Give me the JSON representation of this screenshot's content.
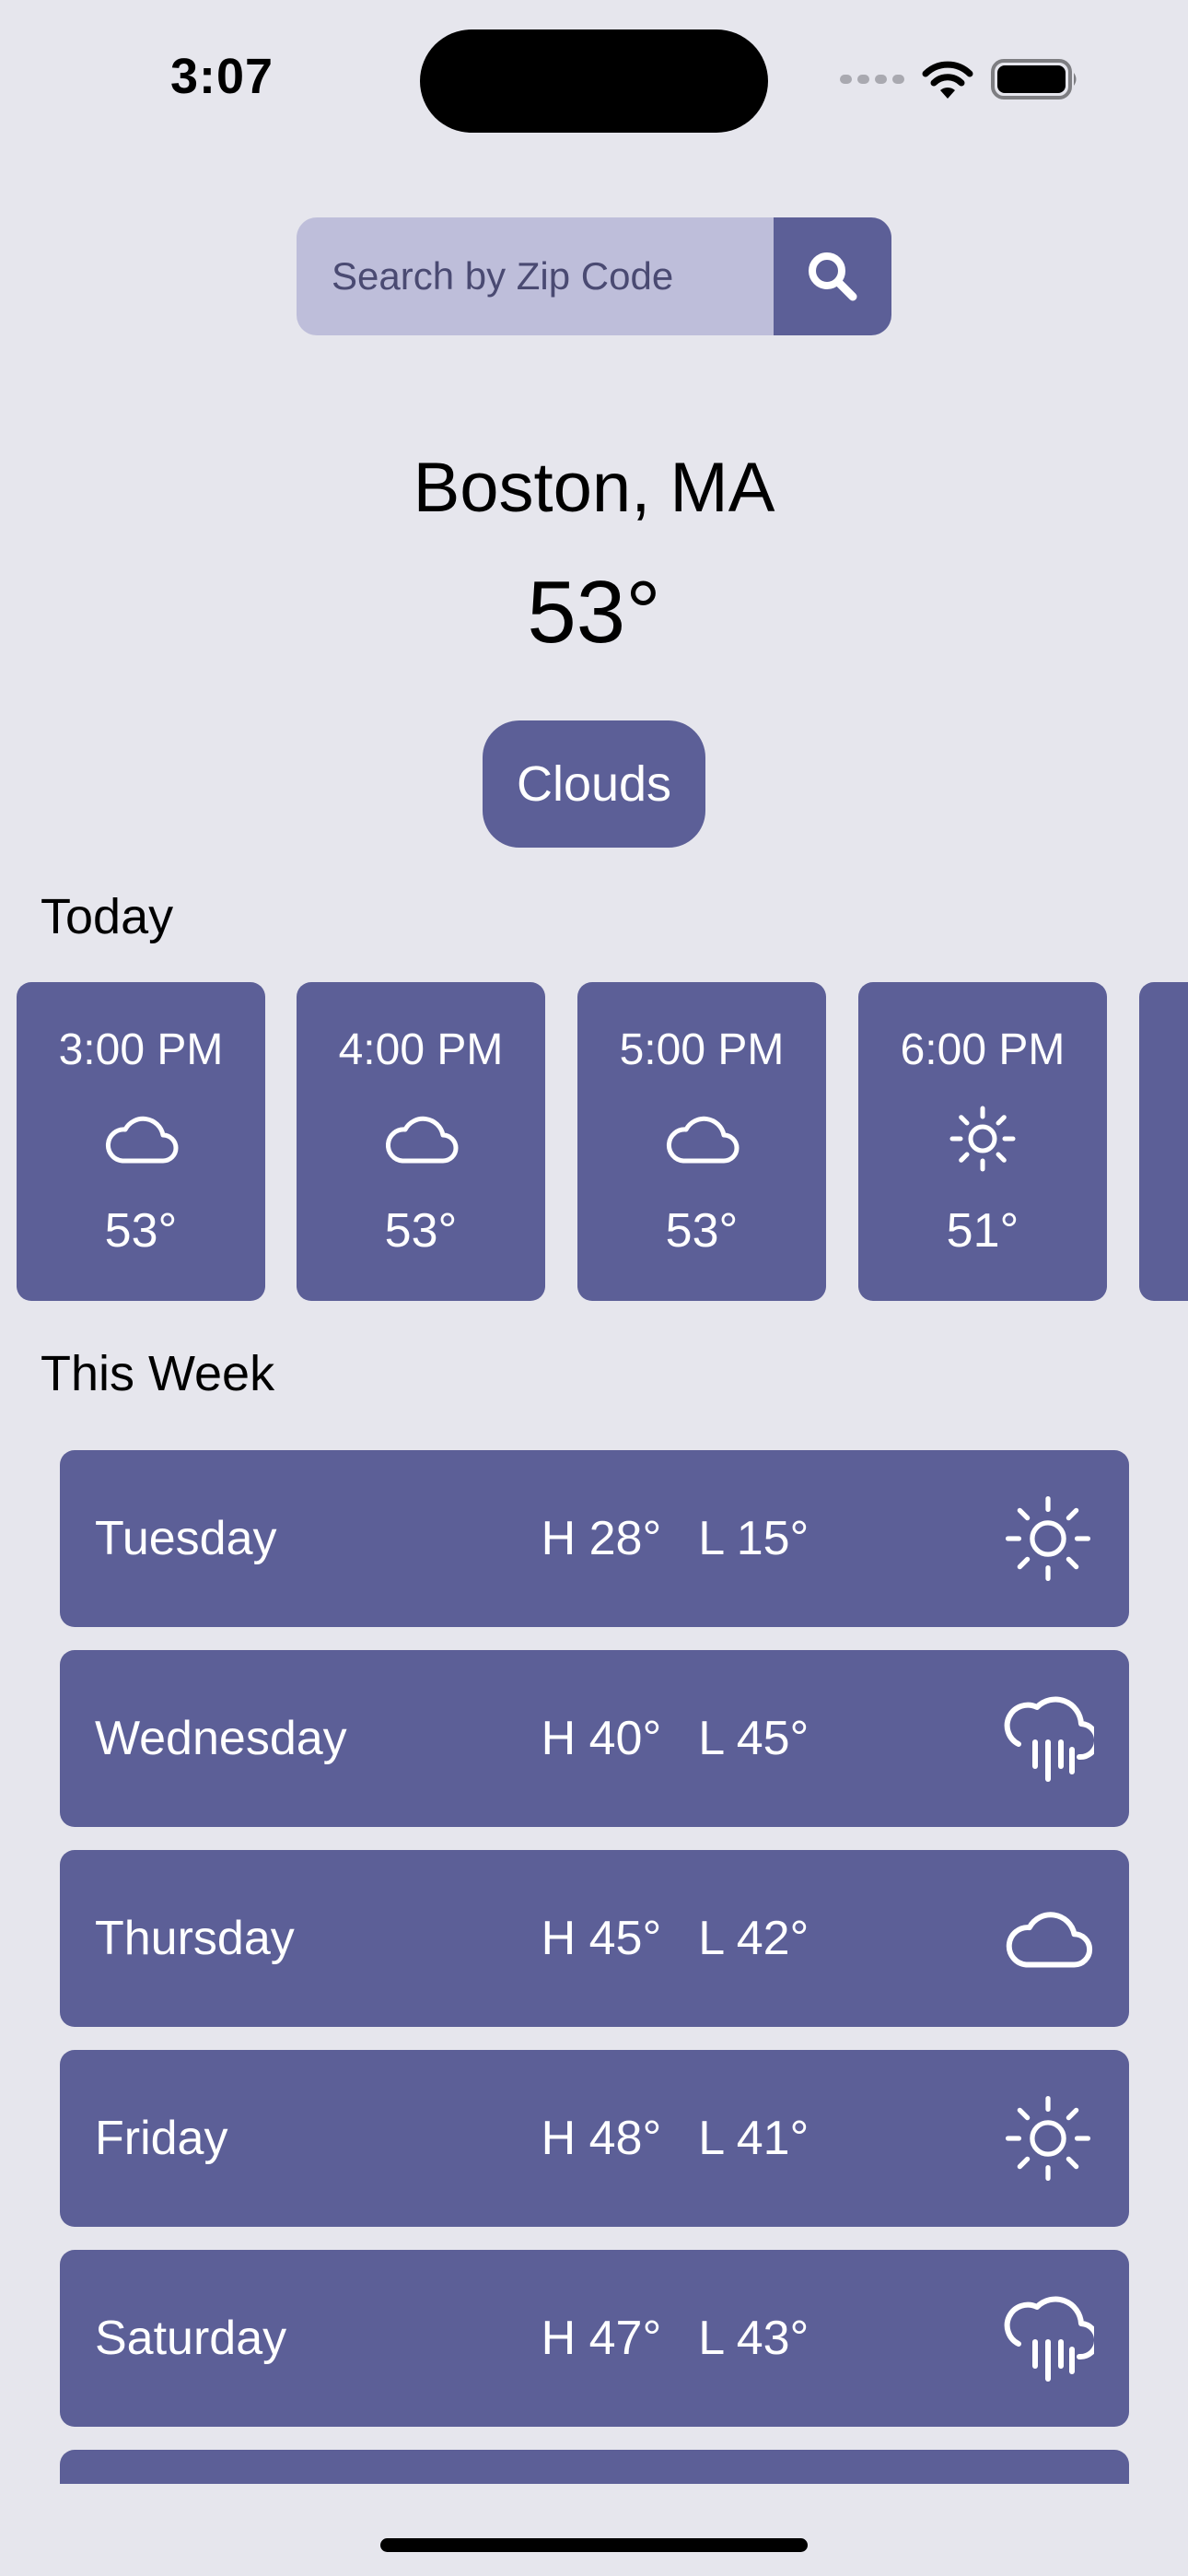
{
  "status": {
    "time": "3:07"
  },
  "search": {
    "placeholder": "Search by Zip Code"
  },
  "current": {
    "city": "Boston, MA",
    "temperature": "53°",
    "condition": "Clouds"
  },
  "today": {
    "title": "Today",
    "hours": [
      {
        "time": "3:00 PM",
        "icon": "cloud-icon",
        "temp": "53°"
      },
      {
        "time": "4:00 PM",
        "icon": "cloud-icon",
        "temp": "53°"
      },
      {
        "time": "5:00 PM",
        "icon": "cloud-icon",
        "temp": "53°"
      },
      {
        "time": "6:00 PM",
        "icon": "sun-icon",
        "temp": "51°"
      }
    ]
  },
  "week": {
    "title": "This Week",
    "days": [
      {
        "day": "Tuesday",
        "high": "H 28°",
        "low": "L 15°",
        "icon": "sun-icon"
      },
      {
        "day": "Wednesday",
        "high": "H 40°",
        "low": "L 45°",
        "icon": "rain-icon"
      },
      {
        "day": "Thursday",
        "high": "H 45°",
        "low": "L 42°",
        "icon": "cloud-icon"
      },
      {
        "day": "Friday",
        "high": "H 48°",
        "low": "L 41°",
        "icon": "sun-icon"
      },
      {
        "day": "Saturday",
        "high": "H 47°",
        "low": "L 43°",
        "icon": "rain-icon"
      }
    ]
  },
  "colors": {
    "accent": "#5C5F97",
    "background": "#E6E6ED",
    "search_field": "#BEBEDA"
  }
}
